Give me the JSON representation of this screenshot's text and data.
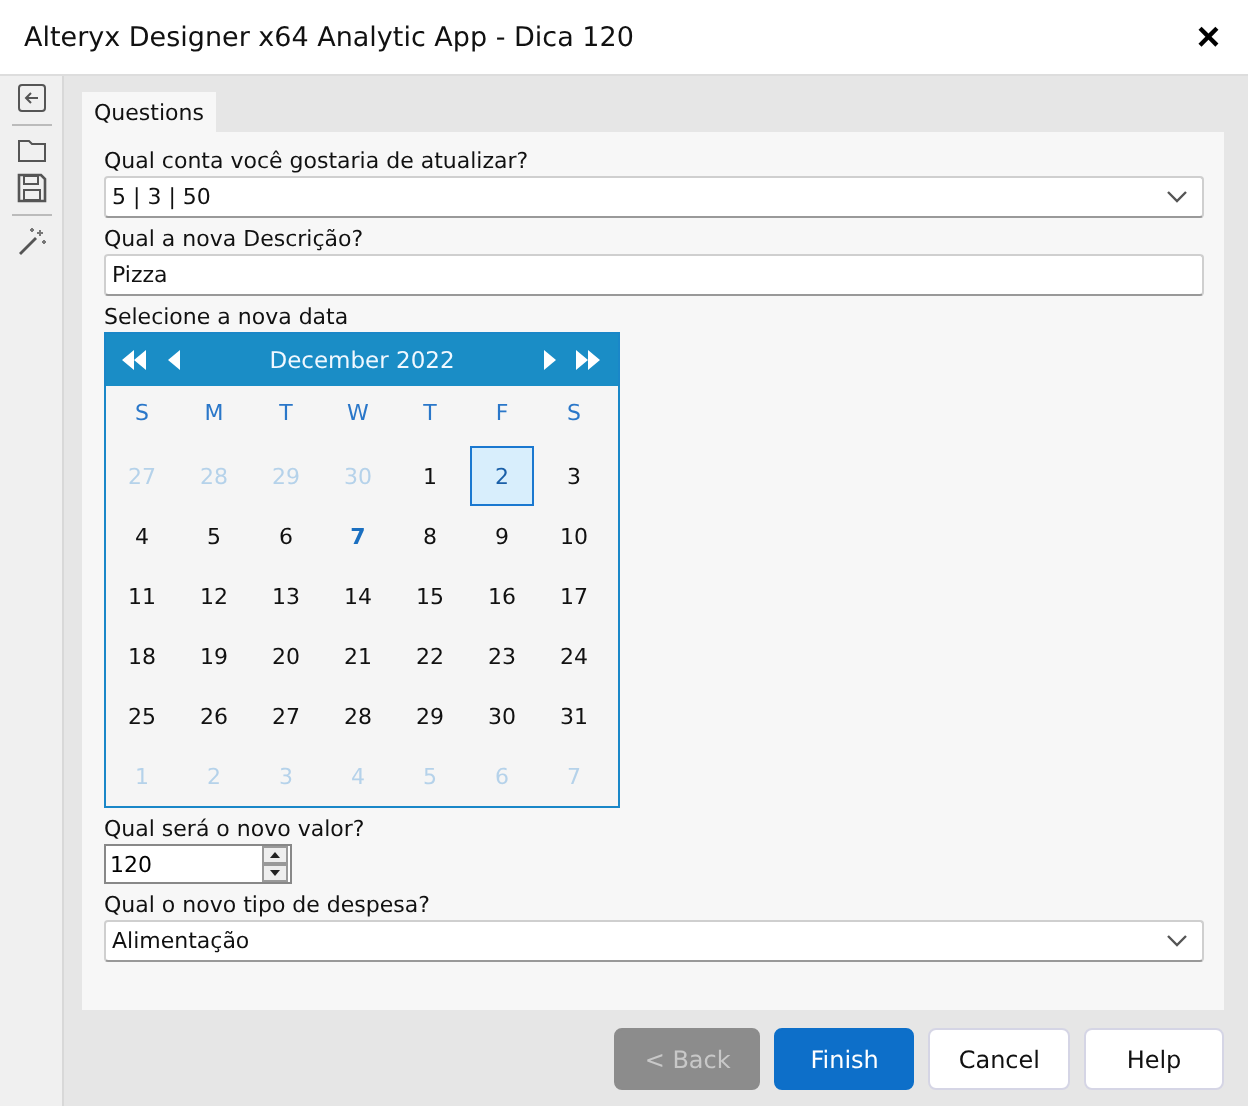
{
  "window": {
    "title": "Alteryx Designer x64 Analytic App - Dica 120",
    "close": "×"
  },
  "tabs": [
    {
      "label": "Questions",
      "selected": true
    }
  ],
  "questions": [
    {
      "kind": "dropdown",
      "label": "Qual conta você gostaria de atualizar?",
      "value": "5 | 3 | 50"
    },
    {
      "kind": "text",
      "label": "Qual a nova Descrição?",
      "value": "Pizza"
    },
    {
      "kind": "calendar",
      "label": "Selecione a nova data",
      "month": "December 2022",
      "weekdays": [
        "S",
        "M",
        "T",
        "W",
        "T",
        "F",
        "S"
      ],
      "days": [
        {
          "label": "27",
          "kind": "other",
          "selected": false
        },
        {
          "label": "28",
          "kind": "other",
          "selected": false
        },
        {
          "label": "29",
          "kind": "other",
          "selected": false
        },
        {
          "label": "30",
          "kind": "other",
          "selected": false
        },
        {
          "label": "1",
          "kind": "current",
          "selected": false
        },
        {
          "label": "2",
          "kind": "current",
          "selected": true
        },
        {
          "label": "3",
          "kind": "current",
          "selected": false
        },
        {
          "label": "4",
          "kind": "current",
          "selected": false
        },
        {
          "label": "5",
          "kind": "current",
          "selected": false
        },
        {
          "label": "6",
          "kind": "current",
          "selected": false
        },
        {
          "label": "7",
          "kind": "today",
          "selected": false
        },
        {
          "label": "8",
          "kind": "current",
          "selected": false
        },
        {
          "label": "9",
          "kind": "current",
          "selected": false
        },
        {
          "label": "10",
          "kind": "current",
          "selected": false
        },
        {
          "label": "11",
          "kind": "current",
          "selected": false
        },
        {
          "label": "12",
          "kind": "current",
          "selected": false
        },
        {
          "label": "13",
          "kind": "current",
          "selected": false
        },
        {
          "label": "14",
          "kind": "current",
          "selected": false
        },
        {
          "label": "15",
          "kind": "current",
          "selected": false
        },
        {
          "label": "16",
          "kind": "current",
          "selected": false
        },
        {
          "label": "17",
          "kind": "current",
          "selected": false
        },
        {
          "label": "18",
          "kind": "current",
          "selected": false
        },
        {
          "label": "19",
          "kind": "current",
          "selected": false
        },
        {
          "label": "20",
          "kind": "current",
          "selected": false
        },
        {
          "label": "21",
          "kind": "current",
          "selected": false
        },
        {
          "label": "22",
          "kind": "current",
          "selected": false
        },
        {
          "label": "23",
          "kind": "current",
          "selected": false
        },
        {
          "label": "24",
          "kind": "current",
          "selected": false
        },
        {
          "label": "25",
          "kind": "current",
          "selected": false
        },
        {
          "label": "26",
          "kind": "current",
          "selected": false
        },
        {
          "label": "27",
          "kind": "current",
          "selected": false
        },
        {
          "label": "28",
          "kind": "current",
          "selected": false
        },
        {
          "label": "29",
          "kind": "current",
          "selected": false
        },
        {
          "label": "30",
          "kind": "current",
          "selected": false
        },
        {
          "label": "31",
          "kind": "current",
          "selected": false
        },
        {
          "label": "1",
          "kind": "other",
          "selected": false
        },
        {
          "label": "2",
          "kind": "other",
          "selected": false
        },
        {
          "label": "3",
          "kind": "other",
          "selected": false
        },
        {
          "label": "4",
          "kind": "other",
          "selected": false
        },
        {
          "label": "5",
          "kind": "other",
          "selected": false
        },
        {
          "label": "6",
          "kind": "other",
          "selected": false
        },
        {
          "label": "7",
          "kind": "other",
          "selected": false
        }
      ]
    },
    {
      "kind": "number",
      "label": "Qual será o novo valor?",
      "value": "120"
    },
    {
      "kind": "dropdown",
      "label": "Qual o novo tipo de despesa?",
      "value": "Alimentação"
    }
  ],
  "buttons": [
    {
      "label": "< Back",
      "kind": "secondary",
      "disabled": true
    },
    {
      "label": "Finish",
      "kind": "primary",
      "disabled": false
    },
    {
      "label": "Cancel",
      "kind": "secondary",
      "disabled": false
    },
    {
      "label": "Help",
      "kind": "secondary",
      "disabled": false
    }
  ]
}
